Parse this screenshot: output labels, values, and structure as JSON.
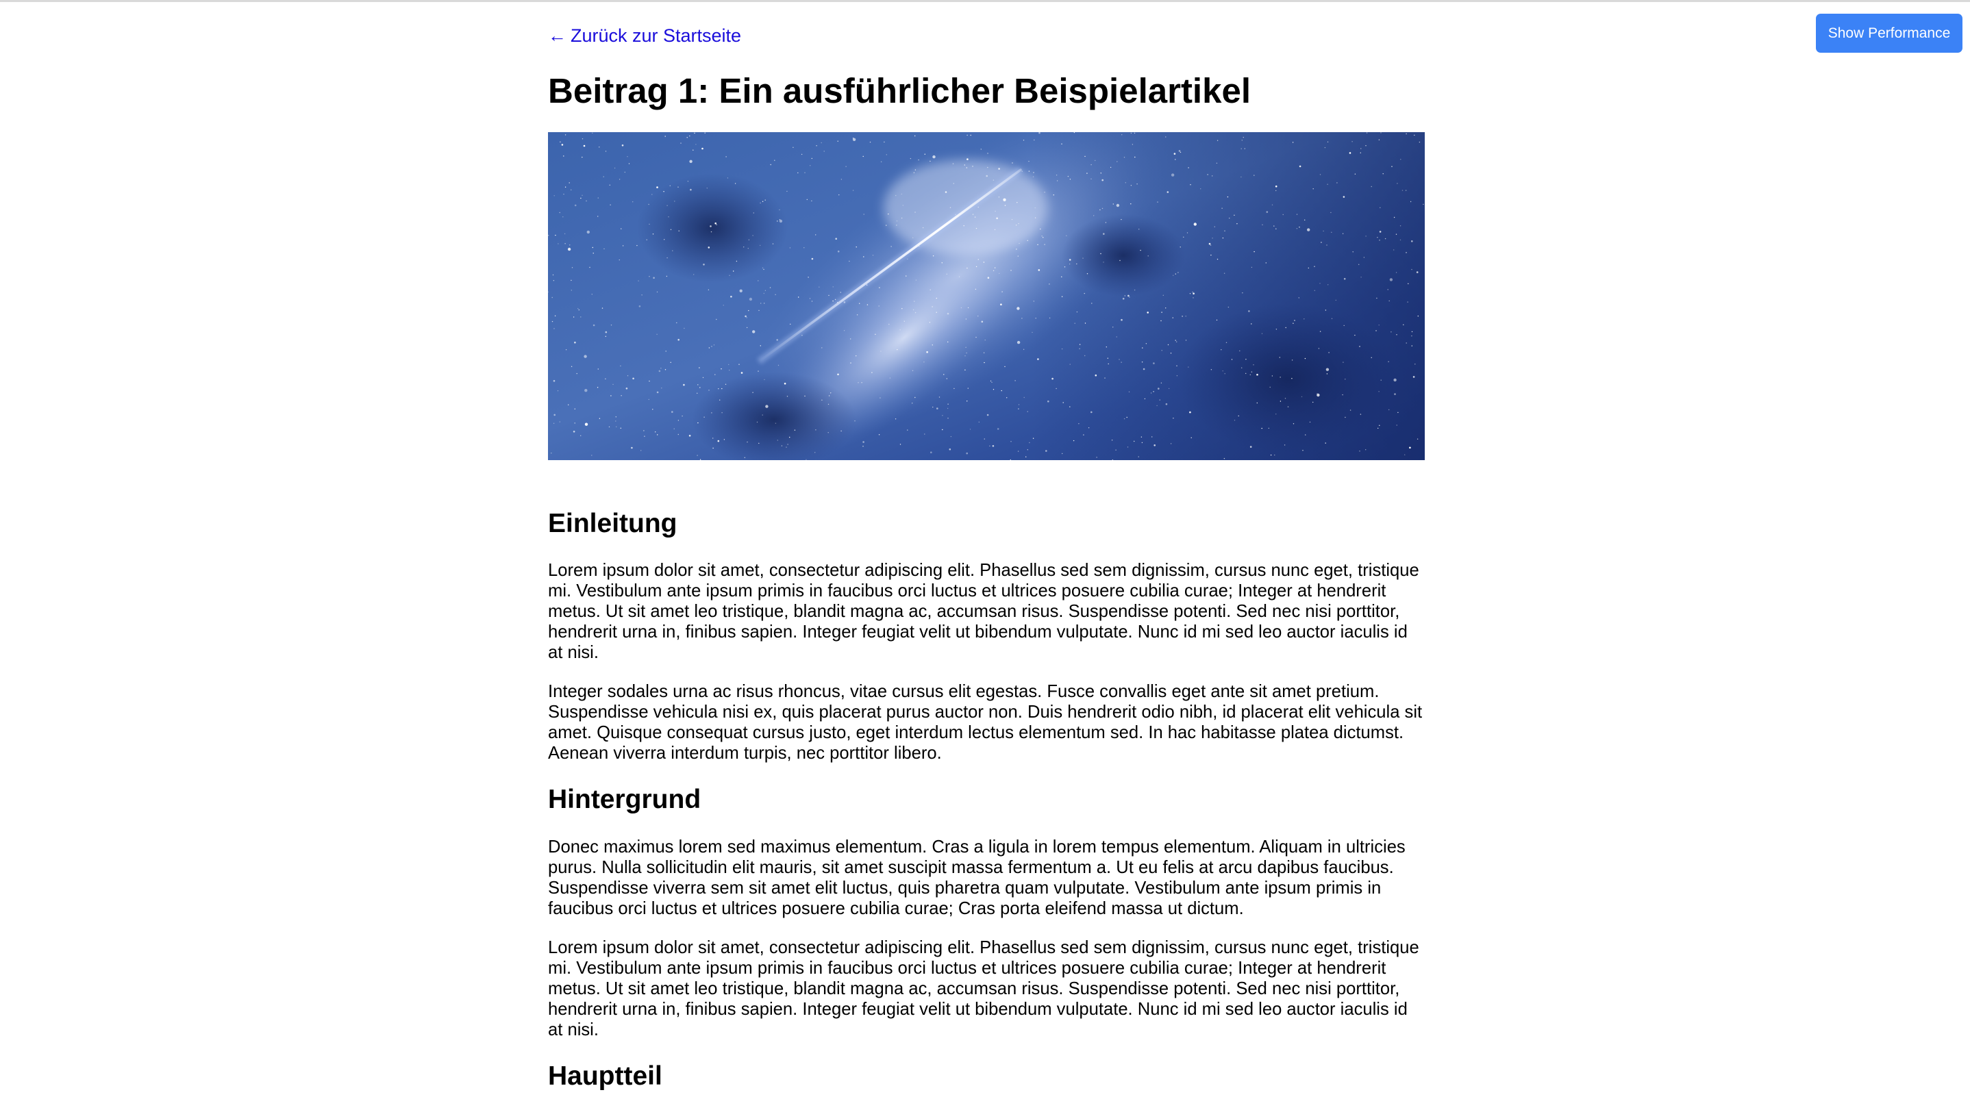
{
  "performance_button": {
    "label": "Show Performance"
  },
  "back_link": {
    "arrow": "←",
    "label": "Zurück zur Startseite"
  },
  "article": {
    "title": "Beitrag 1: Ein ausführlicher Beispielartikel",
    "hero_image": {
      "subject": "starry-sky-with-meteor"
    },
    "sections": [
      {
        "heading": "Einleitung",
        "paragraphs": [
          "Lorem ipsum dolor sit amet, consectetur adipiscing elit. Phasellus sed sem dignissim, cursus nunc eget, tristique mi. Vestibulum ante ipsum primis in faucibus orci luctus et ultrices posuere cubilia curae; Integer at hendrerit metus. Ut sit amet leo tristique, blandit magna ac, accumsan risus. Suspendisse potenti. Sed nec nisi porttitor, hendrerit urna in, finibus sapien. Integer feugiat velit ut bibendum vulputate. Nunc id mi sed leo auctor iaculis id at nisi.",
          "Integer sodales urna ac risus rhoncus, vitae cursus elit egestas. Fusce convallis eget ante sit amet pretium. Suspendisse vehicula nisi ex, quis placerat purus auctor non. Duis hendrerit odio nibh, id placerat elit vehicula sit amet. Quisque consequat cursus justo, eget interdum lectus elementum sed. In hac habitasse platea dictumst. Aenean viverra interdum turpis, nec porttitor libero."
        ]
      },
      {
        "heading": "Hintergrund",
        "paragraphs": [
          "Donec maximus lorem sed maximus elementum. Cras a ligula in lorem tempus elementum. Aliquam in ultricies purus. Nulla sollicitudin elit mauris, sit amet suscipit massa fermentum a. Ut eu felis at arcu dapibus faucibus. Suspendisse viverra sem sit amet elit luctus, quis pharetra quam vulputate. Vestibulum ante ipsum primis in faucibus orci luctus et ultrices posuere cubilia curae; Cras porta eleifend massa ut dictum.",
          "Lorem ipsum dolor sit amet, consectetur adipiscing elit. Phasellus sed sem dignissim, cursus nunc eget, tristique mi. Vestibulum ante ipsum primis in faucibus orci luctus et ultrices posuere cubilia curae; Integer at hendrerit metus. Ut sit amet leo tristique, blandit magna ac, accumsan risus. Suspendisse potenti. Sed nec nisi porttitor, hendrerit urna in, finibus sapien. Integer feugiat velit ut bibendum vulputate. Nunc id mi sed leo auctor iaculis id at nisi."
        ]
      },
      {
        "heading": "Hauptteil",
        "paragraphs": []
      }
    ]
  },
  "colors": {
    "link": "#1a0ddb",
    "button_bg": "#3b82f6",
    "button_text": "#ffffff",
    "text": "#000000",
    "background": "#ffffff"
  }
}
